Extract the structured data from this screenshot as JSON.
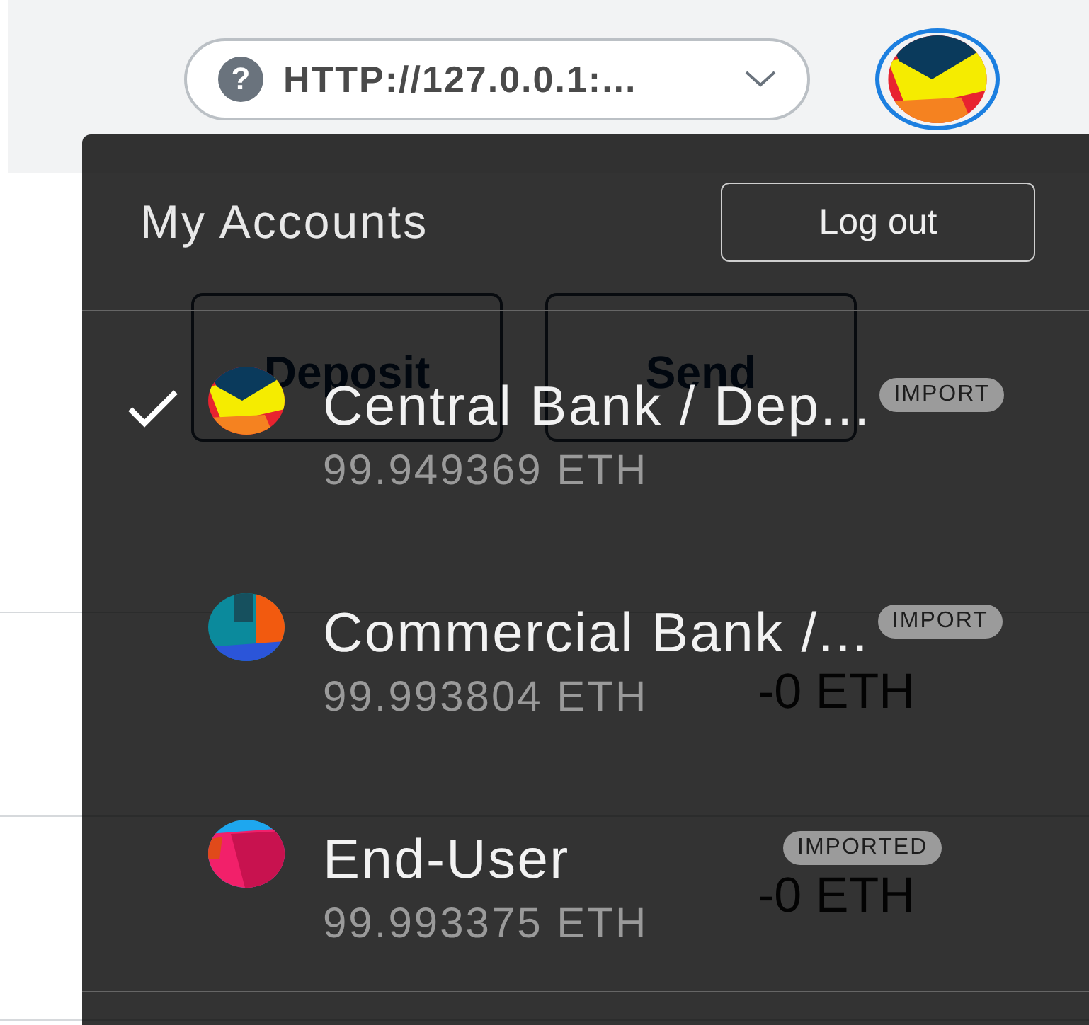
{
  "top_bar": {
    "help_icon": "?",
    "network": "HTTP://127.0.0.1:..."
  },
  "page": {
    "buttons": [
      "Deposit",
      "Send"
    ],
    "amounts": [
      "-0 ETH",
      "-0 ETH"
    ]
  },
  "account_menu": {
    "title": "My Accounts",
    "logout": "Log out",
    "accounts": [
      {
        "name": "Central Bank / Dep...",
        "balance": "99.949369 ETH",
        "badge": "IMPORT",
        "selected": true
      },
      {
        "name": "Commercial Bank /...",
        "balance": "99.993804 ETH",
        "badge": "IMPORT",
        "selected": false
      },
      {
        "name": "End-User",
        "balance": "99.993375 ETH",
        "badge": "IMPORTED",
        "selected": false
      }
    ]
  }
}
